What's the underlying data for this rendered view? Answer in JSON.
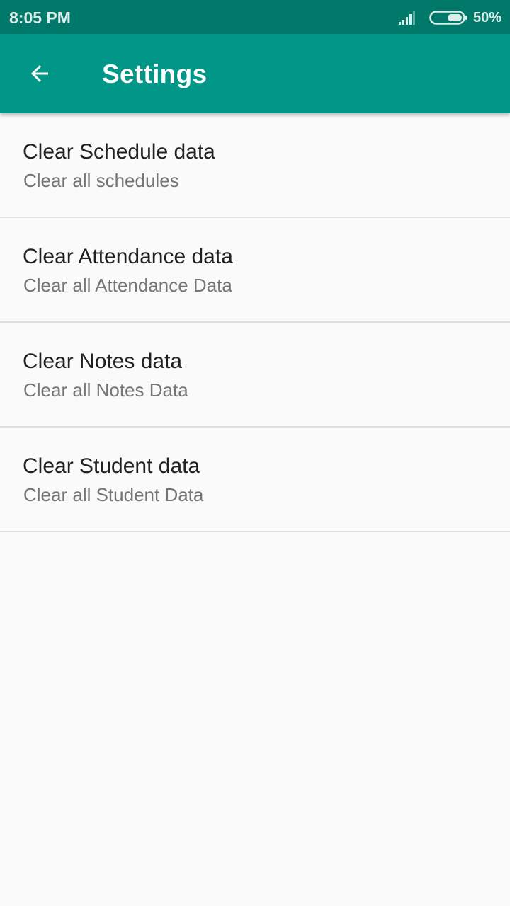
{
  "status_bar": {
    "time": "8:05 PM",
    "battery_percent": "50%",
    "battery_level": 0.5,
    "signal_icon": "signal-icon",
    "battery_icon": "battery-icon"
  },
  "app_bar": {
    "title": "Settings",
    "back_icon": "arrow-back-icon",
    "background": "#009688",
    "status_background": "#00796B"
  },
  "settings": {
    "items": [
      {
        "title": "Clear Schedule data",
        "summary": "Clear all schedules"
      },
      {
        "title": "Clear Attendance data",
        "summary": "Clear all Attendance Data"
      },
      {
        "title": "Clear Notes data",
        "summary": "Clear all Notes Data"
      },
      {
        "title": "Clear Student data",
        "summary": "Clear all Student Data"
      }
    ]
  }
}
